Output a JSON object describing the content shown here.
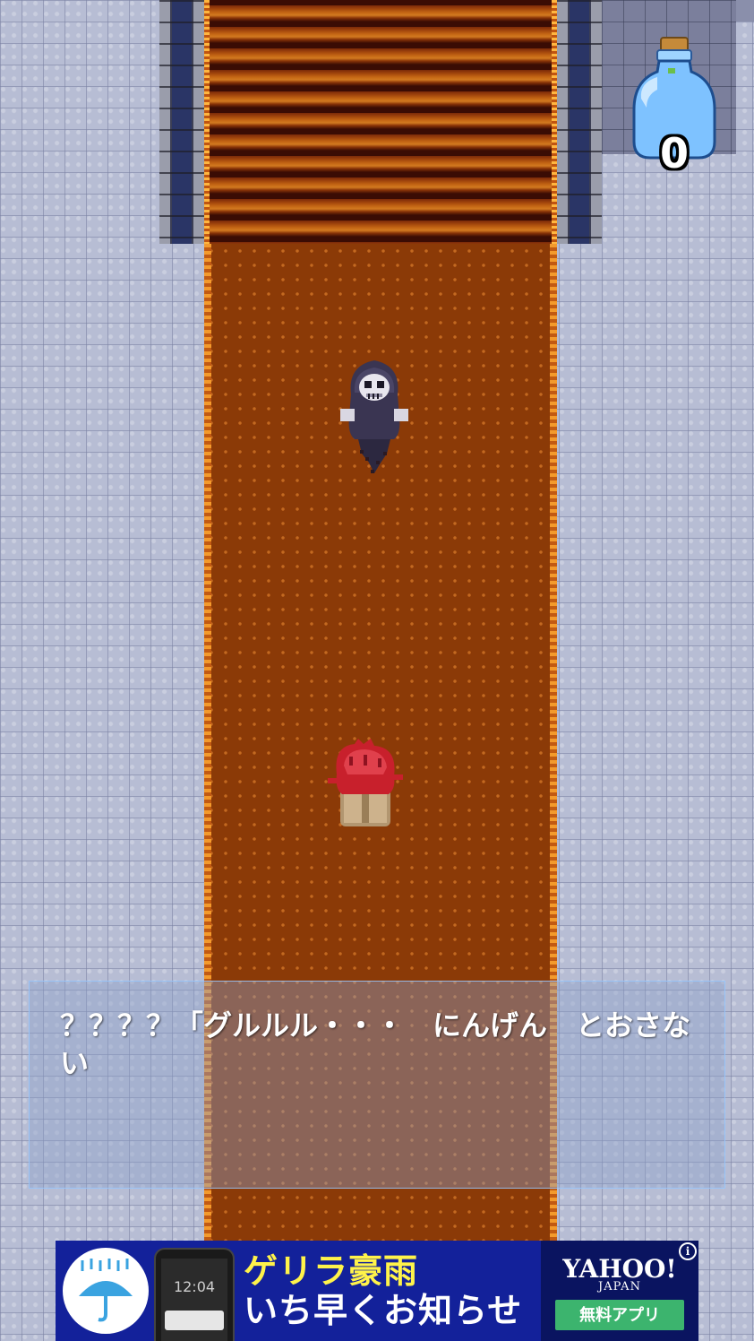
{
  "hud": {
    "potion_count": "0"
  },
  "dialogue": {
    "text": "？？？？「グルルル・・・　にんげん　とおさない"
  },
  "ad": {
    "headline_line1": "ゲリラ豪雨",
    "headline_line2": "いち早くお知らせ",
    "brand": "YAHOO!",
    "brand_sub": "JAPAN",
    "cta_label": "無料アプリ",
    "phone_time": "12:04",
    "info_icon": "i"
  },
  "colors": {
    "carpet": "#8b3a07",
    "floor": "#b7bdd4",
    "ad_background": "#13219a",
    "ad_headline_yellow": "#fff34a",
    "ad_cta_green": "#3cb46e"
  },
  "icons": {
    "potion": "potion-bottle-icon",
    "ad_logo": "umbrella-rain-icon",
    "info": "info-icon"
  }
}
